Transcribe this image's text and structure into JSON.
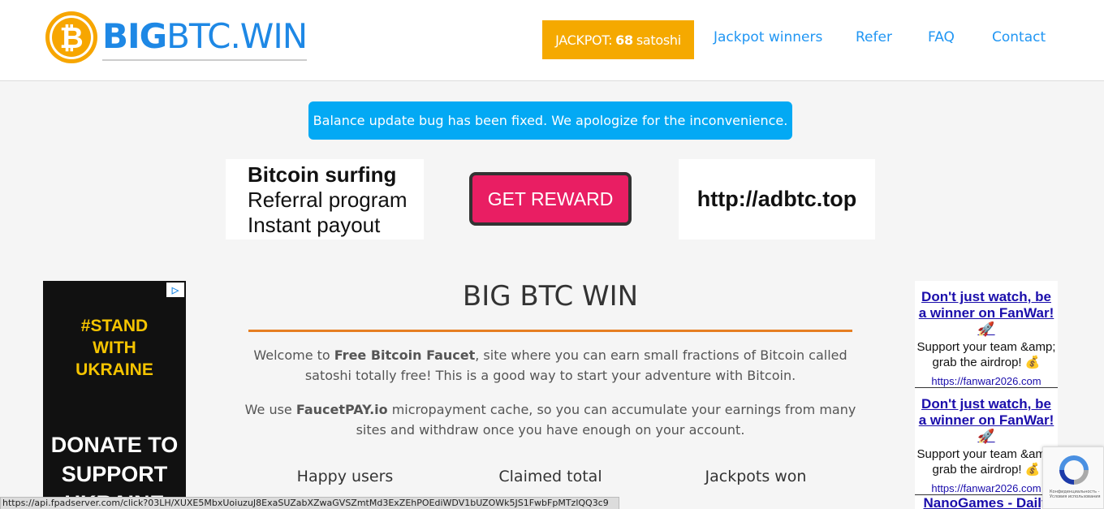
{
  "header": {
    "logo_bold": "BIG",
    "logo_regular": "BTC.WIN",
    "jackpot_prefix": "JACKPOT:",
    "jackpot_amount": "68",
    "jackpot_unit": "satoshi",
    "nav": [
      "Jackpot winners",
      "Refer",
      "FAQ",
      "Contact"
    ]
  },
  "notice": "Balance update bug has been fixed. We apologize for the inconvenience.",
  "banner": {
    "line1": "Bitcoin surfing",
    "line2": "Referral program",
    "line3": "Instant payout",
    "button": "GET REWARD",
    "url": "http://adbtc.top"
  },
  "left_ad": {
    "stand": [
      "#STAND",
      "WITH",
      "UKRAINE"
    ],
    "donate": [
      "DONATE TO",
      "SUPPORT",
      "UKRAINE"
    ]
  },
  "main": {
    "title": "BIG BTC WIN",
    "p1_a": "Welcome to ",
    "p1_b": "Free Bitcoin Faucet",
    "p1_c": ", site where you can earn small fractions of Bitcoin called satoshi totally free! This is a good way to start your adventure with Bitcoin.",
    "p2_a": "We use ",
    "p2_b": "FaucetPAY.io",
    "p2_c": " micropayment cache, so you can accumulate your earnings from many sites and withdraw once you have enough on your account.",
    "stats": [
      "Happy users",
      "Claimed total",
      "Jackpots won"
    ]
  },
  "right_ads": [
    {
      "headline": "Don't just watch, be a winner on FanWar! 🚀",
      "body": "Support your team &amp; grab the airdrop! 💰",
      "url": "https://fanwar2026.com"
    },
    {
      "headline": "Don't just watch, be a winner on FanWar! 🚀",
      "body": "Support your team &amp; grab the airdrop! 💰",
      "url": "https://fanwar2026.com"
    },
    {
      "headline": "NanoGames - Daily"
    }
  ],
  "recaptcha_text": "Конфиденциальность - Условия использования",
  "status_url": "https://api.fpadserver.com/click?03LH/XUXE5MbxUoiuzuJ8ExaSUZabXZwaGVSZmtMd3ExZEhPOEdiWDV1bUZOWk5JS1FwbFpMTzlQQ3c9"
}
